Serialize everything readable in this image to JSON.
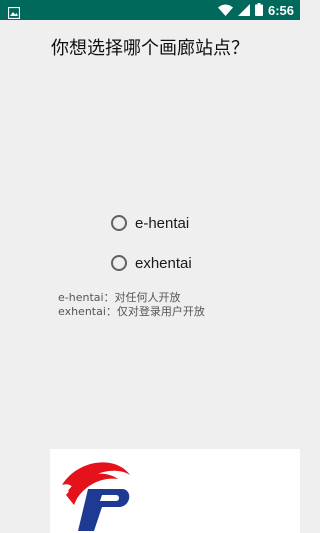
{
  "status_bar": {
    "time": "6:56",
    "left_icon": "image-icon",
    "icons": [
      "wifi-icon",
      "signal-icon",
      "battery-icon"
    ]
  },
  "dialog": {
    "title": "你想选择哪个画廊站点？",
    "options": [
      {
        "label": "e-hentai",
        "selected": false
      },
      {
        "label": "exhentai",
        "selected": false
      }
    ],
    "notes": [
      "e-hentai：对任何人开放",
      "exhentai：仅对登录用户开放"
    ]
  },
  "colors": {
    "status_bar": "#00695c",
    "background": "#efefef",
    "logo_red": "#e3121b",
    "logo_blue": "#1f3a93"
  }
}
